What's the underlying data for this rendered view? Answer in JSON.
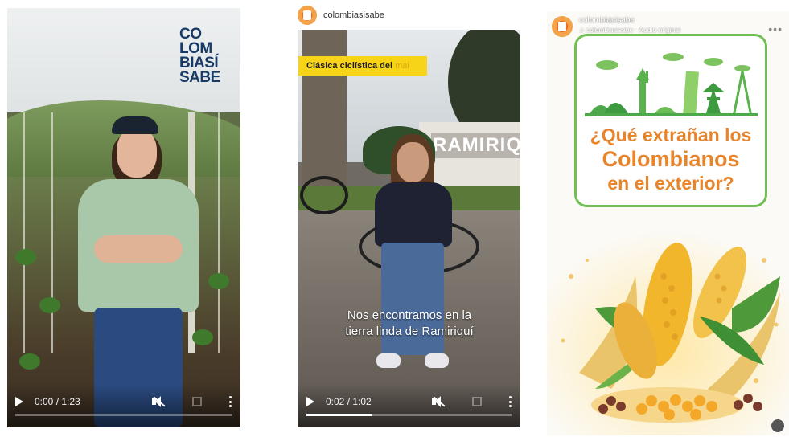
{
  "colors": {
    "accent_yellow": "#f7d417",
    "title_orange": "#e8842a",
    "frame_green": "#6fbf52",
    "logo_navy": "#173a66"
  },
  "video1": {
    "logo": [
      "CO",
      "LOM",
      "BIASÍ",
      "SABE"
    ],
    "time": "0:00 / 1:23",
    "progress_fraction": 0.0,
    "icons": [
      "play-icon",
      "mute-icon",
      "fullscreen-icon",
      "more-icon"
    ]
  },
  "video2": {
    "account": "colombiasisabe",
    "caption_top": "Clásica ciclística del",
    "caption_top_fade": "mai",
    "sign_text": "RAMIRIQ",
    "subtitle_line1": "Nos encontramos en la",
    "subtitle_line2": "tierra linda de Ramiriquí",
    "time": "0:02 / 1:02",
    "progress_fraction": 0.32,
    "icons": [
      "play-icon",
      "mute-icon",
      "fullscreen-icon",
      "more-icon"
    ]
  },
  "post3": {
    "account": "colombiasisabe",
    "audio": "♫ colombiasisabe · Audio original",
    "more": "•••",
    "title_line1": "¿Qué extrañan los",
    "title_line2": "Colombianos",
    "title_line3": "en el exterior?"
  }
}
